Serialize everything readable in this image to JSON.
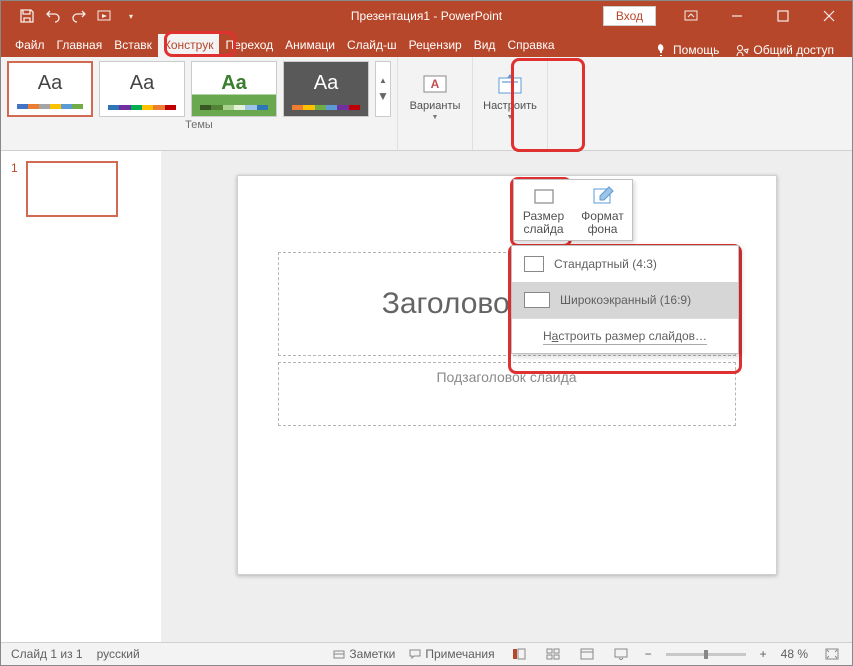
{
  "title": "Презентация1 - PowerPoint",
  "signin": "Вход",
  "tabs": {
    "file": "Файл",
    "home": "Главная",
    "insert": "Вставк",
    "design": "Конструк",
    "transitions": "Переход",
    "animations": "Анимаци",
    "slideshow": "Слайд-ш",
    "review": "Рецензир",
    "view": "Вид",
    "help": "Справка"
  },
  "right": {
    "help": "Помощь",
    "share": "Общий доступ"
  },
  "groups": {
    "themes_label": "Темы",
    "variants": "Варианты",
    "customize": "Настроить"
  },
  "panel": {
    "slide_size": "Размер\nслайда",
    "format_bg": "Формат\nфона"
  },
  "menu": {
    "standard": "Стандартный (4:3)",
    "widescreen": "Широкоэкранный (16:9)",
    "custom_pre": "Н",
    "custom_u": "а",
    "custom_post": "строить размер слайдов…"
  },
  "slide": {
    "title_ph": "Заголовок слайда",
    "subtitle_ph": "Подзаголовок слайда"
  },
  "thumbs": {
    "n1": "1"
  },
  "status": {
    "slide_of": "Слайд 1 из 1",
    "lang": "русский",
    "notes": "Заметки",
    "comments": "Примечания",
    "zoom": "48 %"
  }
}
